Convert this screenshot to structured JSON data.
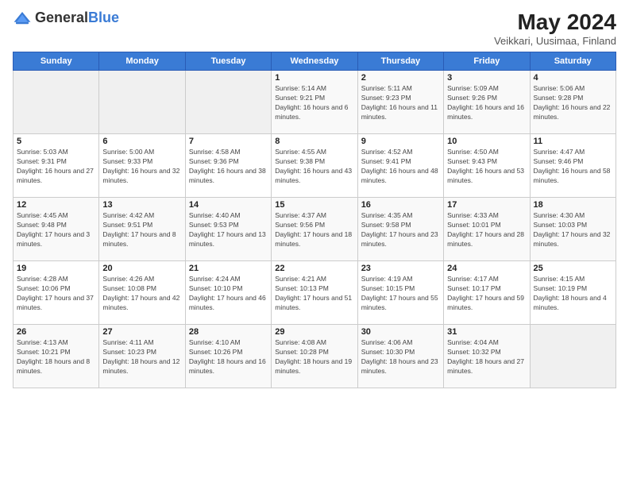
{
  "header": {
    "logo_general": "General",
    "logo_blue": "Blue",
    "title": "May 2024",
    "subtitle": "Veikkari, Uusimaa, Finland"
  },
  "days_of_week": [
    "Sunday",
    "Monday",
    "Tuesday",
    "Wednesday",
    "Thursday",
    "Friday",
    "Saturday"
  ],
  "weeks": [
    [
      {
        "day": "",
        "sunrise": "",
        "sunset": "",
        "daylight": ""
      },
      {
        "day": "",
        "sunrise": "",
        "sunset": "",
        "daylight": ""
      },
      {
        "day": "",
        "sunrise": "",
        "sunset": "",
        "daylight": ""
      },
      {
        "day": "1",
        "sunrise": "Sunrise: 5:14 AM",
        "sunset": "Sunset: 9:21 PM",
        "daylight": "Daylight: 16 hours and 6 minutes."
      },
      {
        "day": "2",
        "sunrise": "Sunrise: 5:11 AM",
        "sunset": "Sunset: 9:23 PM",
        "daylight": "Daylight: 16 hours and 11 minutes."
      },
      {
        "day": "3",
        "sunrise": "Sunrise: 5:09 AM",
        "sunset": "Sunset: 9:26 PM",
        "daylight": "Daylight: 16 hours and 16 minutes."
      },
      {
        "day": "4",
        "sunrise": "Sunrise: 5:06 AM",
        "sunset": "Sunset: 9:28 PM",
        "daylight": "Daylight: 16 hours and 22 minutes."
      }
    ],
    [
      {
        "day": "5",
        "sunrise": "Sunrise: 5:03 AM",
        "sunset": "Sunset: 9:31 PM",
        "daylight": "Daylight: 16 hours and 27 minutes."
      },
      {
        "day": "6",
        "sunrise": "Sunrise: 5:00 AM",
        "sunset": "Sunset: 9:33 PM",
        "daylight": "Daylight: 16 hours and 32 minutes."
      },
      {
        "day": "7",
        "sunrise": "Sunrise: 4:58 AM",
        "sunset": "Sunset: 9:36 PM",
        "daylight": "Daylight: 16 hours and 38 minutes."
      },
      {
        "day": "8",
        "sunrise": "Sunrise: 4:55 AM",
        "sunset": "Sunset: 9:38 PM",
        "daylight": "Daylight: 16 hours and 43 minutes."
      },
      {
        "day": "9",
        "sunrise": "Sunrise: 4:52 AM",
        "sunset": "Sunset: 9:41 PM",
        "daylight": "Daylight: 16 hours and 48 minutes."
      },
      {
        "day": "10",
        "sunrise": "Sunrise: 4:50 AM",
        "sunset": "Sunset: 9:43 PM",
        "daylight": "Daylight: 16 hours and 53 minutes."
      },
      {
        "day": "11",
        "sunrise": "Sunrise: 4:47 AM",
        "sunset": "Sunset: 9:46 PM",
        "daylight": "Daylight: 16 hours and 58 minutes."
      }
    ],
    [
      {
        "day": "12",
        "sunrise": "Sunrise: 4:45 AM",
        "sunset": "Sunset: 9:48 PM",
        "daylight": "Daylight: 17 hours and 3 minutes."
      },
      {
        "day": "13",
        "sunrise": "Sunrise: 4:42 AM",
        "sunset": "Sunset: 9:51 PM",
        "daylight": "Daylight: 17 hours and 8 minutes."
      },
      {
        "day": "14",
        "sunrise": "Sunrise: 4:40 AM",
        "sunset": "Sunset: 9:53 PM",
        "daylight": "Daylight: 17 hours and 13 minutes."
      },
      {
        "day": "15",
        "sunrise": "Sunrise: 4:37 AM",
        "sunset": "Sunset: 9:56 PM",
        "daylight": "Daylight: 17 hours and 18 minutes."
      },
      {
        "day": "16",
        "sunrise": "Sunrise: 4:35 AM",
        "sunset": "Sunset: 9:58 PM",
        "daylight": "Daylight: 17 hours and 23 minutes."
      },
      {
        "day": "17",
        "sunrise": "Sunrise: 4:33 AM",
        "sunset": "Sunset: 10:01 PM",
        "daylight": "Daylight: 17 hours and 28 minutes."
      },
      {
        "day": "18",
        "sunrise": "Sunrise: 4:30 AM",
        "sunset": "Sunset: 10:03 PM",
        "daylight": "Daylight: 17 hours and 32 minutes."
      }
    ],
    [
      {
        "day": "19",
        "sunrise": "Sunrise: 4:28 AM",
        "sunset": "Sunset: 10:06 PM",
        "daylight": "Daylight: 17 hours and 37 minutes."
      },
      {
        "day": "20",
        "sunrise": "Sunrise: 4:26 AM",
        "sunset": "Sunset: 10:08 PM",
        "daylight": "Daylight: 17 hours and 42 minutes."
      },
      {
        "day": "21",
        "sunrise": "Sunrise: 4:24 AM",
        "sunset": "Sunset: 10:10 PM",
        "daylight": "Daylight: 17 hours and 46 minutes."
      },
      {
        "day": "22",
        "sunrise": "Sunrise: 4:21 AM",
        "sunset": "Sunset: 10:13 PM",
        "daylight": "Daylight: 17 hours and 51 minutes."
      },
      {
        "day": "23",
        "sunrise": "Sunrise: 4:19 AM",
        "sunset": "Sunset: 10:15 PM",
        "daylight": "Daylight: 17 hours and 55 minutes."
      },
      {
        "day": "24",
        "sunrise": "Sunrise: 4:17 AM",
        "sunset": "Sunset: 10:17 PM",
        "daylight": "Daylight: 17 hours and 59 minutes."
      },
      {
        "day": "25",
        "sunrise": "Sunrise: 4:15 AM",
        "sunset": "Sunset: 10:19 PM",
        "daylight": "Daylight: 18 hours and 4 minutes."
      }
    ],
    [
      {
        "day": "26",
        "sunrise": "Sunrise: 4:13 AM",
        "sunset": "Sunset: 10:21 PM",
        "daylight": "Daylight: 18 hours and 8 minutes."
      },
      {
        "day": "27",
        "sunrise": "Sunrise: 4:11 AM",
        "sunset": "Sunset: 10:23 PM",
        "daylight": "Daylight: 18 hours and 12 minutes."
      },
      {
        "day": "28",
        "sunrise": "Sunrise: 4:10 AM",
        "sunset": "Sunset: 10:26 PM",
        "daylight": "Daylight: 18 hours and 16 minutes."
      },
      {
        "day": "29",
        "sunrise": "Sunrise: 4:08 AM",
        "sunset": "Sunset: 10:28 PM",
        "daylight": "Daylight: 18 hours and 19 minutes."
      },
      {
        "day": "30",
        "sunrise": "Sunrise: 4:06 AM",
        "sunset": "Sunset: 10:30 PM",
        "daylight": "Daylight: 18 hours and 23 minutes."
      },
      {
        "day": "31",
        "sunrise": "Sunrise: 4:04 AM",
        "sunset": "Sunset: 10:32 PM",
        "daylight": "Daylight: 18 hours and 27 minutes."
      },
      {
        "day": "",
        "sunrise": "",
        "sunset": "",
        "daylight": ""
      }
    ]
  ]
}
